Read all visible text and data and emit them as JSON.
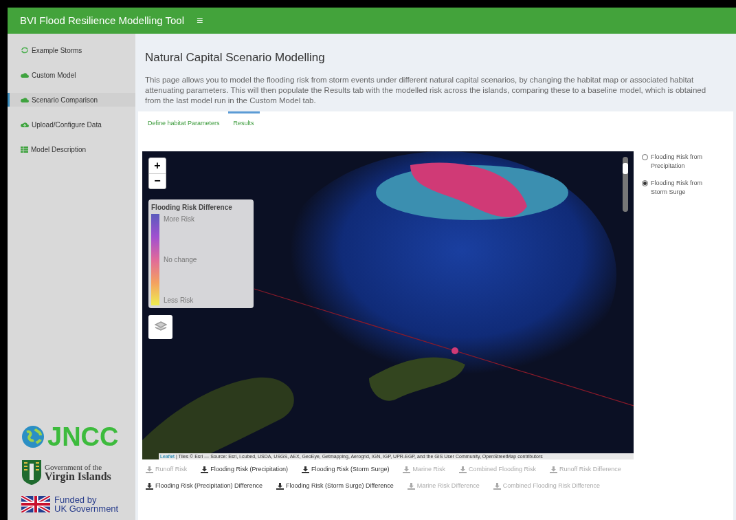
{
  "header": {
    "title": "BVI Flood Resilience Modelling Tool",
    "menu_glyph": "≡"
  },
  "sidebar": {
    "items": [
      {
        "label": "Example Storms",
        "kind": "storm",
        "selected": false
      },
      {
        "label": "Custom Model",
        "kind": "cloud",
        "selected": false
      },
      {
        "label": "Scenario Comparison",
        "kind": "cloud",
        "selected": true
      },
      {
        "label": "Upload/Configure Data",
        "kind": "upload",
        "selected": false
      },
      {
        "label": "Model Description",
        "kind": "table",
        "selected": false
      }
    ],
    "logos": {
      "jncc": "JNCC",
      "gov_line1": "Government of the",
      "gov_line2": "Virgin Islands",
      "funded_line1": "Funded by",
      "funded_line2": "UK Government"
    }
  },
  "page": {
    "title": "Natural Capital Scenario Modelling",
    "description": "This page allows you to model the flooding risk from storm events under different natural capital scenarios, by changing the habitat map or associated habitat attenuating parameters. This will then populate the Results tab with the modelled risk across the islands, comparing these to a baseline model, which is obtained from the last model run in the Custom Model tab."
  },
  "tabs": [
    {
      "label": "Define habitat Parameters",
      "selected": false
    },
    {
      "label": "Results",
      "selected": true
    }
  ],
  "map": {
    "zoom_in": "+",
    "zoom_out": "−",
    "legend": {
      "title": "Flooding Risk Difference",
      "labels": [
        "More Risk",
        "No change",
        "Less Risk"
      ]
    },
    "opacity_slider": {
      "level": 0.85
    },
    "attribution_link": "Leaflet",
    "attribution": "| Tiles © Esri — Source: Esri, i-cubed, USDA, USGS, AEX, GeoEye, Getmapping, Aerogrid, IGN, IGP, UPR-EGP, and the GIS User Community, OpenStreetMap contributors"
  },
  "layers": [
    {
      "label": "Flooding Risk from Precipitation",
      "selected": false
    },
    {
      "label": "Flooding Risk from Storm Surge",
      "selected": true
    }
  ],
  "downloads": [
    {
      "label": "Runoff Risk",
      "disabled": true
    },
    {
      "label": "Flooding Risk (Precipitation)",
      "disabled": false
    },
    {
      "label": "Flooding Risk (Storm Surge)",
      "disabled": false
    },
    {
      "label": "Marine Risk",
      "disabled": true
    },
    {
      "label": "Combined Flooding Risk",
      "disabled": true
    },
    {
      "label": "Runoff Risk Difference",
      "disabled": true
    },
    {
      "label": "Flooding Risk (Precipitation) Difference",
      "disabled": false
    },
    {
      "label": "Flooding Risk (Storm Surge) Difference",
      "disabled": false
    },
    {
      "label": "Marine Risk Difference",
      "disabled": true
    },
    {
      "label": "Combined Flooding Risk Difference",
      "disabled": true
    }
  ]
}
